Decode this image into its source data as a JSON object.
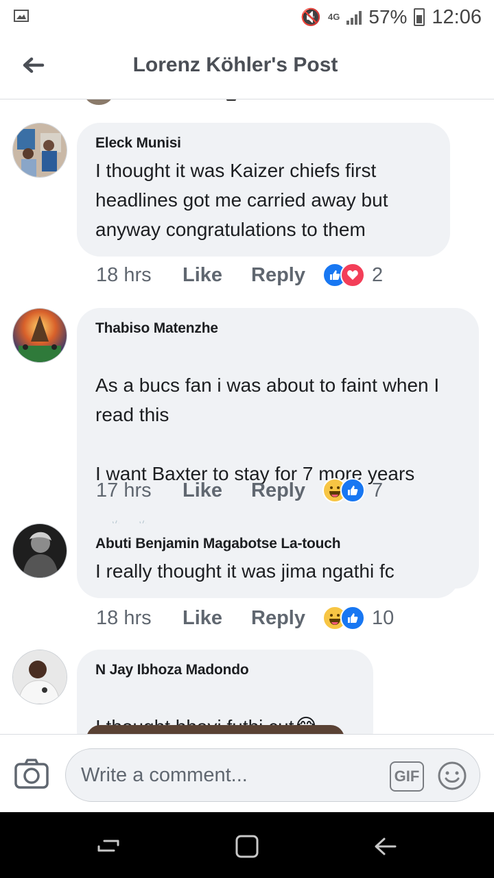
{
  "status_bar": {
    "network": "4G",
    "battery": "57%",
    "time": "12:06"
  },
  "header": {
    "title": "Lorenz Köhler's Post"
  },
  "comments": [
    {
      "author": "Eleck Munisi",
      "text": "I thought it was Kaizer chiefs first headlines got me carried away but anyway congratulations to them",
      "time": "18 hrs",
      "like": "Like",
      "reply": "Reply",
      "reactions": [
        "like",
        "love"
      ],
      "reaction_count": "2"
    },
    {
      "author": "Thabiso Matenzhe",
      "text_lines": [
        "As a bucs fan i was about to faint when I read this",
        "I want Baxter to stay for 7 more years"
      ],
      "emoji": "👏👏",
      "time": "17 hrs",
      "like": "Like",
      "reply": "Reply",
      "reactions": [
        "haha",
        "like"
      ],
      "reaction_count": "7"
    },
    {
      "author": "Abuti Benjamin Magabotse La-touch",
      "text": "I really thought it was jima ngathi fc",
      "time": "18 hrs",
      "like": "Like",
      "reply": "Reply",
      "reactions": [
        "haha",
        "like"
      ],
      "reaction_count": "10"
    },
    {
      "author": "N Jay Ibhoza Madondo",
      "text": "I thought hhayi futhi cut",
      "emoji": "😂"
    }
  ],
  "composer": {
    "placeholder": "Write a comment...",
    "gif_label": "GIF"
  }
}
